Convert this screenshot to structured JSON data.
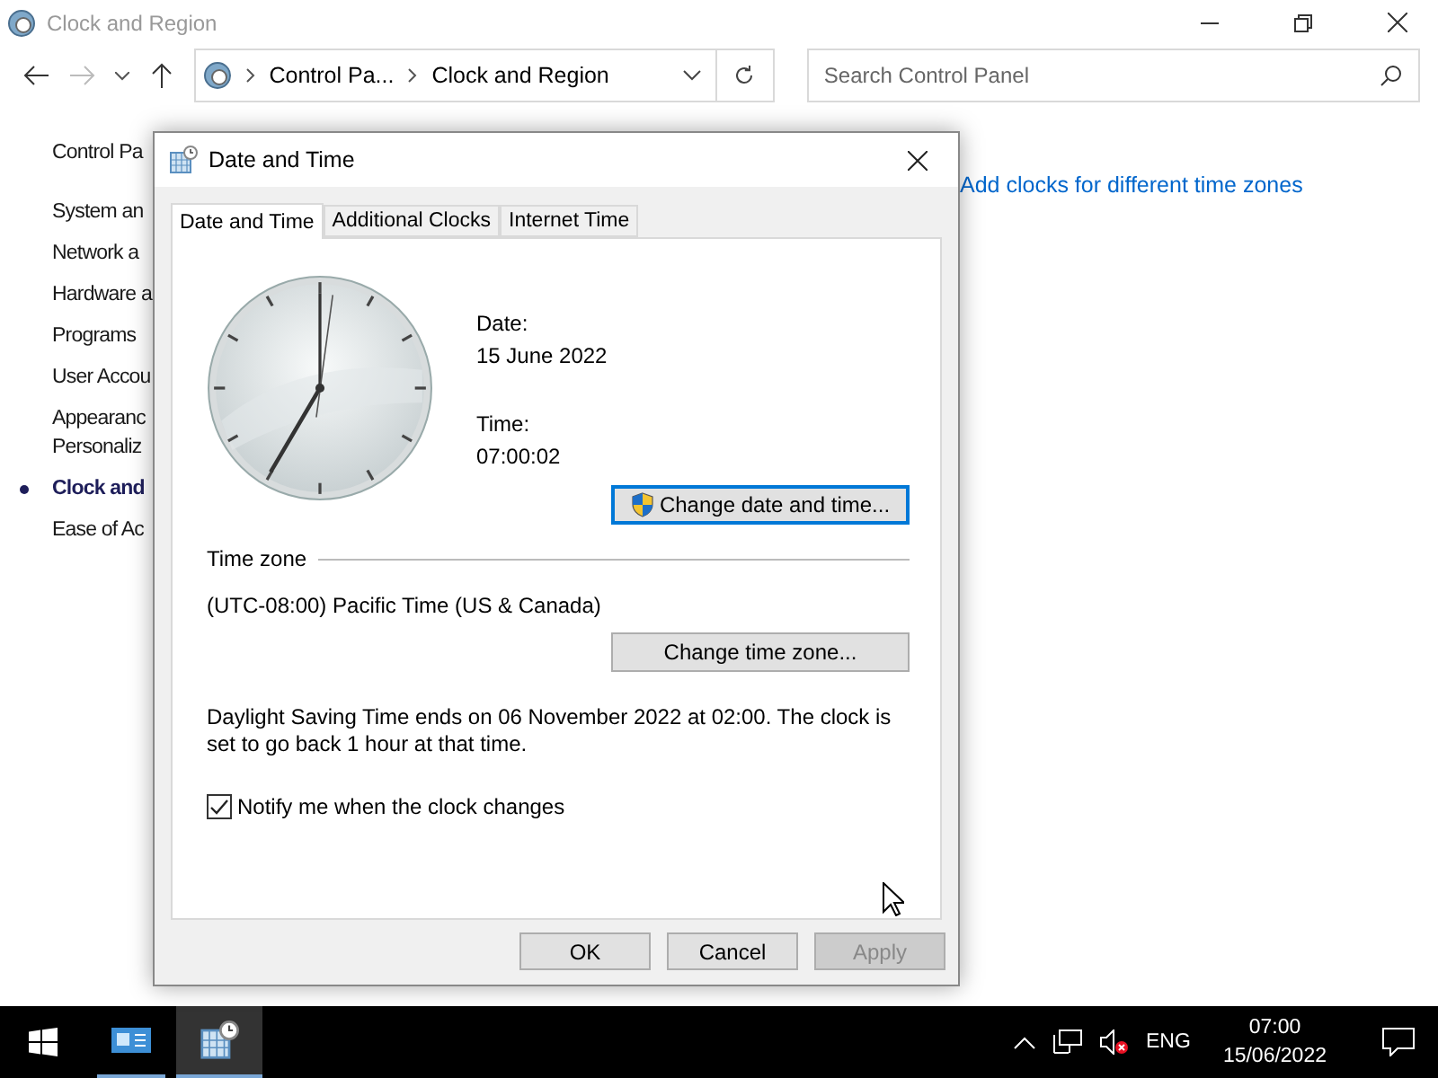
{
  "window": {
    "title": "Clock and Region"
  },
  "address_bar": {
    "breadcrumbs": [
      "Control Pa...",
      "Clock and Region"
    ]
  },
  "search": {
    "placeholder": "Search Control Panel"
  },
  "sidebar": {
    "items": [
      {
        "lines": [
          "Control Pa"
        ],
        "selected": false
      },
      {
        "lines": [
          "System an"
        ],
        "selected": false
      },
      {
        "lines": [
          "Network a"
        ],
        "selected": false
      },
      {
        "lines": [
          "Hardware a"
        ],
        "selected": false
      },
      {
        "lines": [
          "Programs"
        ],
        "selected": false
      },
      {
        "lines": [
          "User Accou"
        ],
        "selected": false
      },
      {
        "lines": [
          "Appearanc",
          "Personaliz"
        ],
        "selected": false
      },
      {
        "lines": [
          "Clock and"
        ],
        "selected": true
      },
      {
        "lines": [
          "Ease of Ac"
        ],
        "selected": false
      }
    ]
  },
  "main_link": "Add clocks for different time zones",
  "dialog": {
    "title": "Date and Time",
    "tabs": [
      {
        "label": "Date and Time",
        "selected": true
      },
      {
        "label": "Additional Clocks",
        "selected": false
      },
      {
        "label": "Internet Time",
        "selected": false
      }
    ],
    "date_label": "Date:",
    "date_value": "15 June 2022",
    "time_label": "Time:",
    "time_value": "07:00:02",
    "change_datetime_button": "Change date and time...",
    "timezone_heading": "Time zone",
    "timezone_value": "(UTC-08:00) Pacific Time (US & Canada)",
    "change_timezone_button": "Change time zone...",
    "dst_note": "Daylight Saving Time ends on 06 November 2022 at 02:00. The clock is set to go back 1 hour at that time.",
    "notify": {
      "label": "Notify me when the clock changes",
      "checked": true
    },
    "buttons": [
      {
        "label": "OK",
        "disabled": false
      },
      {
        "label": "Cancel",
        "disabled": false
      },
      {
        "label": "Apply",
        "disabled": true
      }
    ]
  },
  "taskbar": {
    "language": "ENG",
    "time": "07:00",
    "date": "15/06/2022"
  }
}
